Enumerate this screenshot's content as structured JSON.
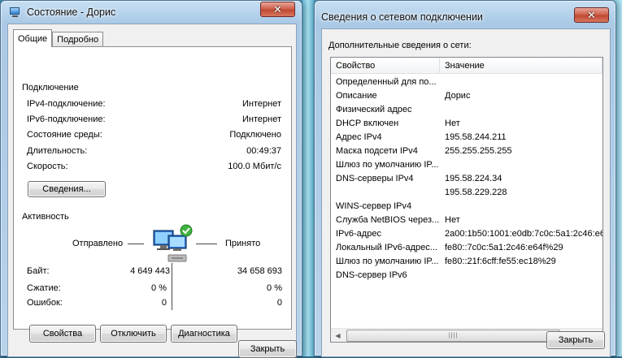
{
  "left_window": {
    "title": "Состояние - Дорис",
    "close_glyph": "✕",
    "tabs": [
      {
        "label": "Общие"
      },
      {
        "label": "Подробно"
      }
    ],
    "connection": {
      "header": "Подключение",
      "rows": [
        {
          "label": "IPv4-подключение:",
          "value": "Интернет"
        },
        {
          "label": "IPv6-подключение:",
          "value": "Интернет"
        },
        {
          "label": "Состояние среды:",
          "value": "Подключено"
        },
        {
          "label": "Длительность:",
          "value": "00:49:37"
        },
        {
          "label": "Скорость:",
          "value": "100.0 Мбит/с"
        }
      ],
      "details_button": "Сведения..."
    },
    "activity": {
      "header": "Активность",
      "sent_label": "Отправлено",
      "received_label": "Принято",
      "rows": [
        {
          "label": "Байт:",
          "sent": "4 649 443",
          "received": "34 658 693"
        },
        {
          "label": "Сжатие:",
          "sent": "0 %",
          "received": "0 %"
        },
        {
          "label": "Ошибок:",
          "sent": "0",
          "received": "0"
        }
      ]
    },
    "buttons": {
      "properties": "Свойства",
      "disable": "Отключить",
      "diagnose": "Диагностика",
      "close": "Закрыть"
    }
  },
  "right_window": {
    "title": "Сведения о сетевом подключении",
    "close_glyph": "✕",
    "section_label": "Дополнительные сведения о сети:",
    "columns": [
      "Свойство",
      "Значение"
    ],
    "rows": [
      {
        "property": "Определенный для по...",
        "value": ""
      },
      {
        "property": "Описание",
        "value": "Дорис"
      },
      {
        "property": "Физический адрес",
        "value": ""
      },
      {
        "property": "DHCP включен",
        "value": "Нет"
      },
      {
        "property": "Адрес IPv4",
        "value": "195.58.244.211"
      },
      {
        "property": "Маска подсети IPv4",
        "value": "255.255.255.255"
      },
      {
        "property": "Шлюз по умолчанию IP...",
        "value": ""
      },
      {
        "property": "DNS-серверы IPv4",
        "value": "195.58.224.34"
      },
      {
        "property": "",
        "value": "195.58.229.228"
      },
      {
        "property": "WINS-сервер IPv4",
        "value": ""
      },
      {
        "property": "Служба NetBIOS через...",
        "value": "Нет"
      },
      {
        "property": "IPv6-адрес",
        "value": "2a00:1b50:1001:e0db:7c0c:5a1:2c46:e6"
      },
      {
        "property": "Локальный IPv6-адрес...",
        "value": "fe80::7c0c:5a1:2c46:e64f%29"
      },
      {
        "property": "Шлюз по умолчанию IP...",
        "value": "fe80::21f:6cff:fe55:ec18%29"
      },
      {
        "property": "DNS-сервер IPv6",
        "value": ""
      }
    ],
    "scrollbar_grip": "||||",
    "close_button": "Закрыть"
  }
}
